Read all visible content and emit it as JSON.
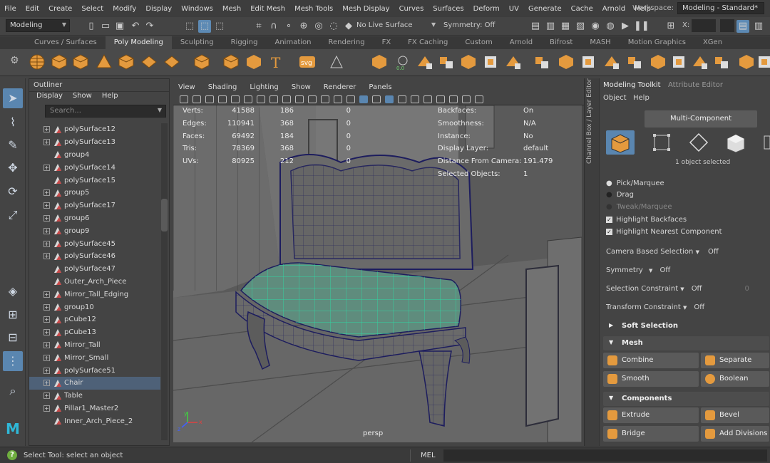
{
  "menubar": {
    "items": [
      "File",
      "Edit",
      "Create",
      "Select",
      "Modify",
      "Display",
      "Windows",
      "Mesh",
      "Edit Mesh",
      "Mesh Tools",
      "Mesh Display",
      "Curves",
      "Surfaces",
      "Deform",
      "UV",
      "Generate",
      "Cache",
      "Arnold",
      "Help"
    ],
    "workspace_label": "Workspace:",
    "workspace_value": "Modeling - Standard*"
  },
  "statusline": {
    "mode": "Modeling",
    "live_surface": "No Live Surface",
    "symmetry": "Symmetry: Off",
    "x_label": "X:"
  },
  "shelf": {
    "tabs": [
      "Curves / Surfaces",
      "Poly Modeling",
      "Sculpting",
      "Rigging",
      "Animation",
      "Rendering",
      "FX",
      "FX Caching",
      "Custom",
      "Arnold",
      "Bifrost",
      "MASH",
      "Motion Graphics",
      "XGen"
    ],
    "active_tab": "Poly Modeling",
    "icons": [
      "sphere-icon",
      "cube-icon",
      "cylinder-icon",
      "cone-icon",
      "torus-icon",
      "plane-icon",
      "disc-icon",
      "platonic-icon",
      "soccer-ball-icon",
      "superellipse-icon",
      "type-icon",
      "svg-icon",
      "sweep-mesh-icon",
      "remesh-icon",
      "retopo-icon",
      "combine-icon",
      "separate-icon",
      "extract-icon",
      "smooth-icon",
      "average-icon",
      "boolean-icon",
      "mirror-icon",
      "bridge-icon",
      "extrude-icon",
      "bevel-icon",
      "fill-hole-icon",
      "multi-cut-icon",
      "target-weld-icon",
      "connect-icon",
      "quad-draw-icon",
      "uv-editor-icon",
      "sculpt-icon"
    ]
  },
  "outliner": {
    "title": "Outliner",
    "menu": [
      "Display",
      "Show",
      "Help"
    ],
    "search_placeholder": "Search...",
    "items": [
      {
        "name": "polySurface12",
        "expander": true,
        "icon": "mesh"
      },
      {
        "name": "polySurface13",
        "expander": true,
        "icon": "mesh"
      },
      {
        "name": "group4",
        "expander": false,
        "icon": "mesh"
      },
      {
        "name": "polySurface14",
        "expander": true,
        "icon": "mesh"
      },
      {
        "name": "polySurface15",
        "expander": false,
        "icon": "mesh"
      },
      {
        "name": "group5",
        "expander": true,
        "icon": "mesh"
      },
      {
        "name": "polySurface17",
        "expander": true,
        "icon": "mesh"
      },
      {
        "name": "group6",
        "expander": true,
        "icon": "mesh"
      },
      {
        "name": "group9",
        "expander": true,
        "icon": "mesh"
      },
      {
        "name": "polySurface45",
        "expander": true,
        "icon": "mesh"
      },
      {
        "name": "polySurface46",
        "expander": true,
        "icon": "mesh"
      },
      {
        "name": "polySurface47",
        "expander": false,
        "icon": "mesh"
      },
      {
        "name": "Outer_Arch_Piece",
        "expander": false,
        "icon": "mesh"
      },
      {
        "name": "Mirror_Tall_Edging",
        "expander": true,
        "icon": "mesh"
      },
      {
        "name": "group10",
        "expander": true,
        "icon": "mesh"
      },
      {
        "name": "pCube12",
        "expander": true,
        "icon": "mesh"
      },
      {
        "name": "pCube13",
        "expander": true,
        "icon": "mesh"
      },
      {
        "name": "Mirror_Tall",
        "expander": true,
        "icon": "mesh"
      },
      {
        "name": "Mirror_Small",
        "expander": true,
        "icon": "mesh"
      },
      {
        "name": "polySurface51",
        "expander": true,
        "icon": "mesh"
      },
      {
        "name": "Chair",
        "expander": true,
        "icon": "mesh",
        "selected": true
      },
      {
        "name": "Table",
        "expander": true,
        "icon": "mesh"
      },
      {
        "name": "Pillar1_Master2",
        "expander": true,
        "icon": "mesh"
      },
      {
        "name": "Inner_Arch_Piece_2",
        "expander": false,
        "icon": "mesh"
      }
    ]
  },
  "viewport": {
    "menu": [
      "View",
      "Shading",
      "Lighting",
      "Show",
      "Renderer",
      "Panels"
    ],
    "camera": "persp",
    "hud_left": [
      {
        "label": "Verts:",
        "v1": "41588",
        "v2": "186",
        "v3": "0"
      },
      {
        "label": "Edges:",
        "v1": "110941",
        "v2": "368",
        "v3": "0"
      },
      {
        "label": "Faces:",
        "v1": "69492",
        "v2": "184",
        "v3": "0"
      },
      {
        "label": "Tris:",
        "v1": "78369",
        "v2": "368",
        "v3": "0"
      },
      {
        "label": "UVs:",
        "v1": "80925",
        "v2": "212",
        "v3": "0"
      }
    ],
    "hud_right": [
      {
        "label": "Backfaces:",
        "value": "On"
      },
      {
        "label": "Smoothness:",
        "value": "N/A"
      },
      {
        "label": "Instance:",
        "value": "No"
      },
      {
        "label": "Display Layer:",
        "value": "default"
      },
      {
        "label": "Distance From Camera:",
        "value": "191.479"
      },
      {
        "label": "Selected Objects:",
        "value": "1"
      }
    ],
    "axis": {
      "x": "x",
      "y": "y",
      "z": "z"
    }
  },
  "channel_box_label": "Channel Box / Layer Editor",
  "toolkit": {
    "tab_active": "Modeling Toolkit",
    "tab_inactive": "Attribute Editor",
    "menu": [
      "Object",
      "Help"
    ],
    "multi_component": "Multi-Component",
    "selected_text": "1 object selected",
    "pick_marquee": "Pick/Marquee",
    "drag": "Drag",
    "tweak_marquee": "Tweak/Marquee",
    "highlight_backfaces": "Highlight Backfaces",
    "highlight_nearest": "Highlight Nearest Component",
    "camera_based_label": "Camera Based Selection",
    "camera_based_value": "Off",
    "symmetry_label": "Symmetry",
    "symmetry_value": "Off",
    "sel_constraint_label": "Selection Constraint",
    "sel_constraint_value": "Off",
    "sel_constraint_num": "0",
    "transform_constraint_label": "Transform Constraint",
    "transform_constraint_value": "Off",
    "soft_selection": "Soft Selection",
    "mesh_section": "Mesh",
    "combine": "Combine",
    "separate": "Separate",
    "smooth": "Smooth",
    "boolean": "Boolean",
    "components_section": "Components",
    "extrude": "Extrude",
    "bevel": "Bevel",
    "bridge": "Bridge",
    "add_divisions": "Add Divisions"
  },
  "helpline": {
    "text": "Select Tool: select an object",
    "mel_label": "MEL"
  },
  "colors": {
    "accent": "#5a86b0",
    "shelf_orange": "#e49a3e",
    "selection_green": "#3fd9b0",
    "wire": "#1d1d5e"
  }
}
